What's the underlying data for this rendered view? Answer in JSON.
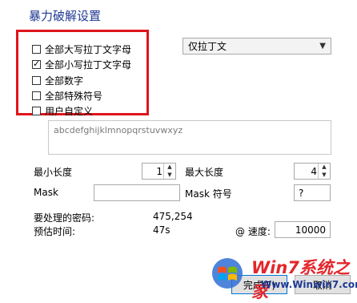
{
  "title": "暴力破解设置",
  "charsets": [
    {
      "label": "全部大写拉丁文字母",
      "checked": false
    },
    {
      "label": "全部小写拉丁文字母",
      "checked": true
    },
    {
      "label": "全部数字",
      "checked": false
    },
    {
      "label": "全部特殊符号",
      "checked": false
    },
    {
      "label": "用户自定义",
      "checked": false
    }
  ],
  "language_select": {
    "value": "仅拉丁文"
  },
  "charset_preview": "abcdefghijklmnopqrstuvwxyz",
  "min_length": {
    "label": "最小长度",
    "value": "1"
  },
  "max_length": {
    "label": "最大长度",
    "value": "4"
  },
  "mask": {
    "label": "Mask",
    "value": ""
  },
  "mask_symbol": {
    "label": "Mask 符号",
    "value": "?"
  },
  "passwords_to_process": {
    "label": "要处理的密码:",
    "value": "475,254"
  },
  "estimated_time": {
    "label": "预估时间:",
    "value": "47s"
  },
  "speed": {
    "label": "@ 速度:",
    "value": "10000"
  },
  "buttons": {
    "finish": "完成(F)",
    "cancel": "取消"
  },
  "watermark": {
    "brand": "Win7系统之家",
    "url": "Www.Winwin7.com"
  },
  "colors": {
    "title": "#1f3a93",
    "highlight": "#e0141b",
    "button_focus": "#0078d7"
  }
}
